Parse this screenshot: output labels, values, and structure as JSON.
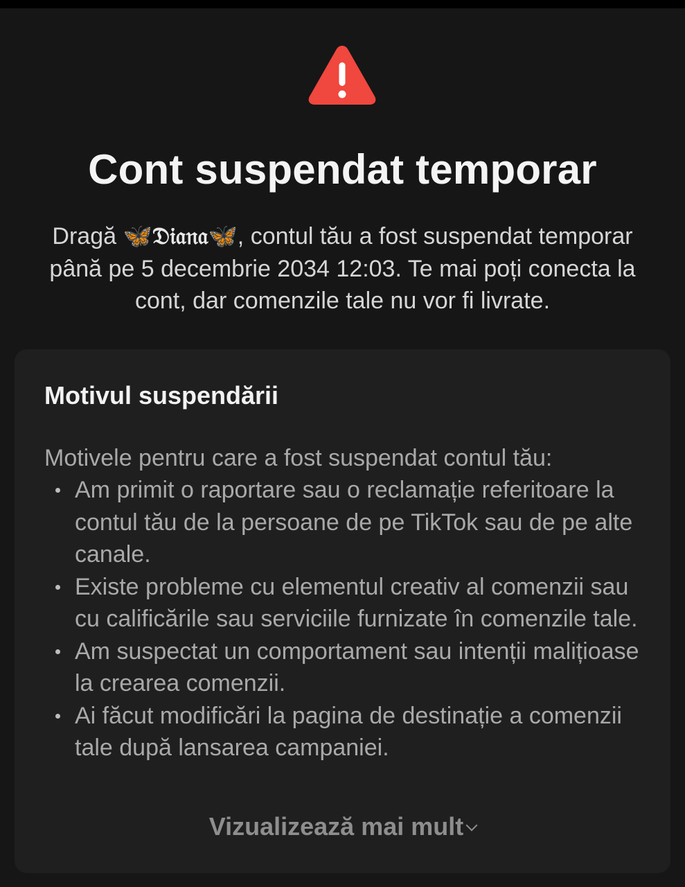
{
  "header": {
    "title": "Cont suspendat temporar",
    "accent_color": "#f0473e"
  },
  "intro": {
    "greeting": "Dragă",
    "username_decor": "🦋",
    "username": "𝔇𝔦𝔞𝔫𝔞",
    "message": ", contul tău a fost suspendat temporar până pe 5 decembrie 2034 12:03. Te mai poți conecta la cont, dar comenzile tale nu vor fi livrate."
  },
  "card": {
    "title": "Motivul suspendării",
    "reasons_intro": "Motivele pentru care a fost suspendat contul tău:",
    "reasons": [
      "Am primit o raportare sau o reclamație referitoare la contul tău de la persoane de pe TikTok sau de pe alte canale.",
      "Existe probleme cu elementul creativ al comenzii sau cu calificările sau serviciile furnizate în comenzile tale.",
      "Am suspectat un comportament sau intenții malițioase la crearea comenzii.",
      "Ai făcut modificări la pagina de destinație a comenzii tale după lansarea campaniei."
    ],
    "view_more_label": "Vizualizează mai mult",
    "view_more_icon": "chevron-down-icon"
  }
}
